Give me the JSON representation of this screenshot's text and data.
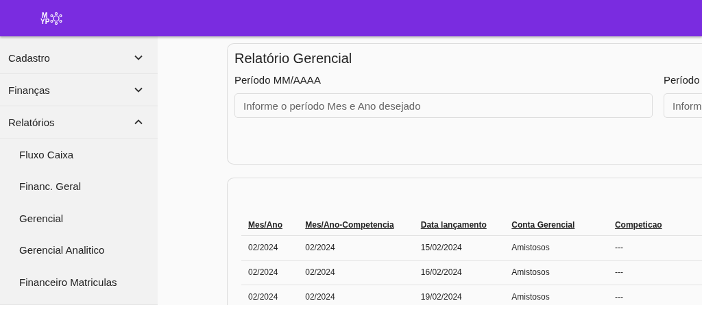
{
  "header": {
    "logo": [
      "M",
      "YP"
    ]
  },
  "sidebar": {
    "items": [
      {
        "label": "Cadastro",
        "expanded": false
      },
      {
        "label": "Finanças",
        "expanded": false
      },
      {
        "label": "Relatórios",
        "expanded": true,
        "children": [
          {
            "label": "Fluxo Caixa"
          },
          {
            "label": "Financ. Geral"
          },
          {
            "label": "Gerencial"
          },
          {
            "label": "Gerencial Analitico"
          },
          {
            "label": "Financeiro Matriculas"
          }
        ]
      }
    ]
  },
  "filter_card": {
    "title": "Relatório Gerencial",
    "fields": [
      {
        "label": "Período MM/AAAA",
        "placeholder": "Informe o período Mes e Ano desejado"
      },
      {
        "label": "Período",
        "placeholder": "Inform"
      }
    ]
  },
  "table": {
    "columns": [
      "Mes/Ano",
      "Mes/Ano-Competencia",
      "Data lançamento",
      "Conta Gerencial",
      "Competicao"
    ],
    "rows": [
      [
        "02/2024",
        "02/2024",
        "15/02/2024",
        "Amistosos",
        "---"
      ],
      [
        "02/2024",
        "02/2024",
        "16/02/2024",
        "Amistosos",
        "---"
      ],
      [
        "02/2024",
        "02/2024",
        "19/02/2024",
        "Amistosos",
        "---"
      ]
    ]
  }
}
